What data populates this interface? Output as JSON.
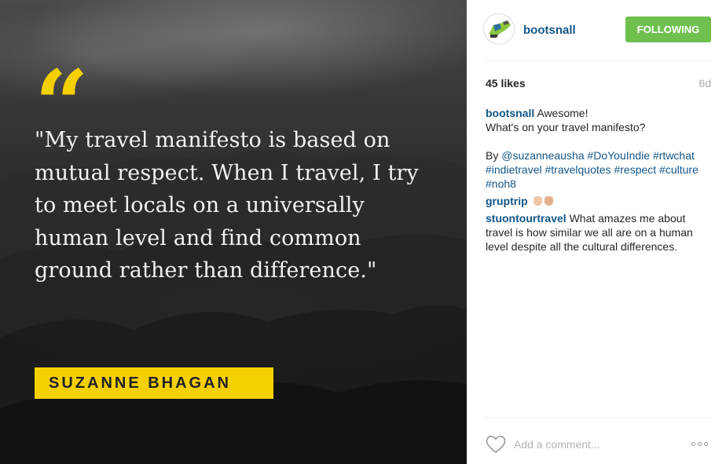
{
  "post": {
    "image": {
      "quote_mark": "“",
      "quote": "\"My travel manifesto is based on mutual respect. When I travel, I try to meet locals on a universally human level and find common ground rather than difference.\"",
      "author": "SUZANNE BHAGAN",
      "accent_color": "#f5d000"
    },
    "header": {
      "username": "bootsnall",
      "follow_label": "FOLLOWING",
      "follow_color": "#70c050"
    },
    "stats": {
      "likes": "45 likes",
      "age": "6d"
    },
    "caption": {
      "username": "bootsnall",
      "line1": "Awesome!",
      "line2": "What's on your travel manifesto?",
      "by": "By",
      "mention": "@suzanneausha",
      "hashtags": [
        "#DoYouIndie",
        "#rtwchat",
        "#indietravel",
        "#travelquotes",
        "#respect",
        "#culture",
        "#noh8"
      ]
    },
    "comments": [
      {
        "username": "gruptrip",
        "text": "",
        "emojis": [
          "clap-emoji",
          "clap-emoji"
        ]
      },
      {
        "username": "stuontourtravel",
        "text": "What amazes me about travel is how similar we all are on a human level despite all the cultural differences."
      }
    ],
    "composer": {
      "placeholder": "Add a comment...",
      "like_icon": "heart-outline-icon",
      "more_icon": "more-options-icon"
    }
  }
}
